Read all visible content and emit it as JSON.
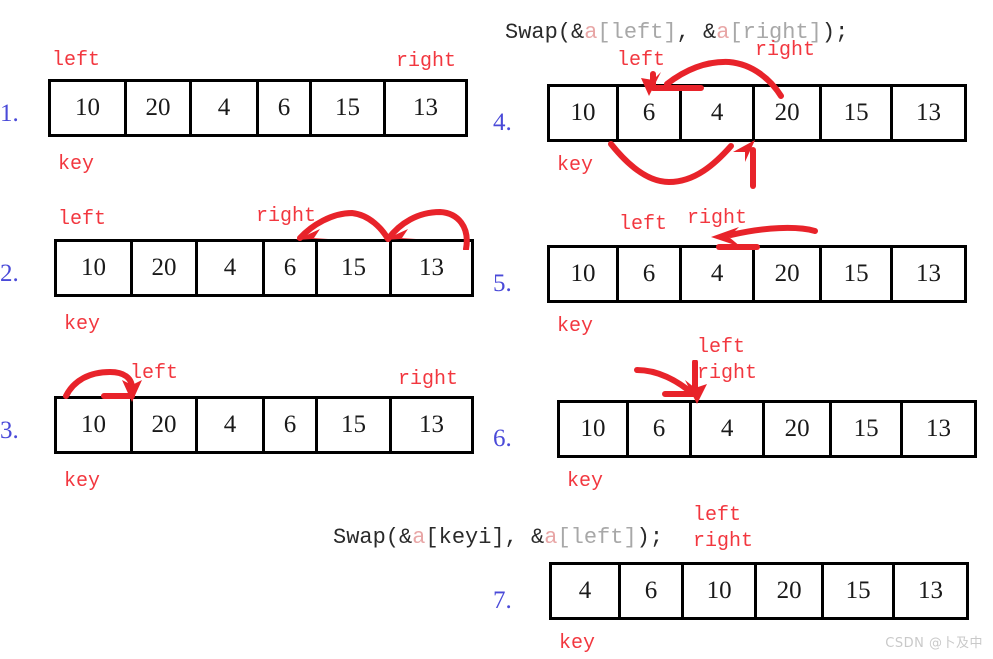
{
  "page": {
    "watermark": "CSDN @卜及中",
    "label_left": "left",
    "label_right": "right",
    "label_key": "key"
  },
  "colors": {
    "annotation_red": "#f2373f",
    "ink_red": "#e8232a",
    "step_number_blue": "#4a4ad8",
    "cell_border": "#000000",
    "code_text": "#2a2a2a",
    "code_var": "#e8a6a6",
    "code_index": "#a8a8a8",
    "watermark": "#c9c9c9"
  },
  "code_lines": {
    "swap_left_right": {
      "prefix": "Swap(&",
      "var1": "a",
      "index1": "[left]",
      "middle": ", &",
      "var2": "a",
      "index2": "[right]",
      "suffix": ");"
    },
    "swap_keyi_left": {
      "prefix": "Swap(&",
      "var1": "a",
      "index1": "[keyi]",
      "middle": ", &",
      "var2": "a",
      "index2": "[left]",
      "suffix": ");"
    }
  },
  "steps": [
    {
      "number": "1.",
      "cells": [
        "10",
        "20",
        "4",
        "6",
        "15",
        "13"
      ],
      "labels": {
        "left": "left",
        "right": "right",
        "key": "key"
      }
    },
    {
      "number": "2.",
      "cells": [
        "10",
        "20",
        "4",
        "6",
        "15",
        "13"
      ],
      "labels": {
        "left": "left",
        "right": "right",
        "key": "key"
      }
    },
    {
      "number": "3.",
      "cells": [
        "10",
        "20",
        "4",
        "6",
        "15",
        "13"
      ],
      "labels": {
        "left": "left",
        "right": "right",
        "key": "key"
      }
    },
    {
      "number": "4.",
      "cells": [
        "10",
        "6",
        "4",
        "20",
        "15",
        "13"
      ],
      "labels": {
        "left": "left",
        "right": "right",
        "key": "key"
      }
    },
    {
      "number": "5.",
      "cells": [
        "10",
        "6",
        "4",
        "20",
        "15",
        "13"
      ],
      "labels": {
        "left": "left",
        "right": "right",
        "key": "key"
      }
    },
    {
      "number": "6.",
      "cells": [
        "10",
        "6",
        "4",
        "20",
        "15",
        "13"
      ],
      "labels": {
        "left": "left",
        "right": "right",
        "key": "key"
      }
    },
    {
      "number": "7.",
      "cells": [
        "4",
        "6",
        "10",
        "20",
        "15",
        "13"
      ],
      "labels": {
        "left": "left",
        "right": "right",
        "key": "key"
      }
    }
  ]
}
